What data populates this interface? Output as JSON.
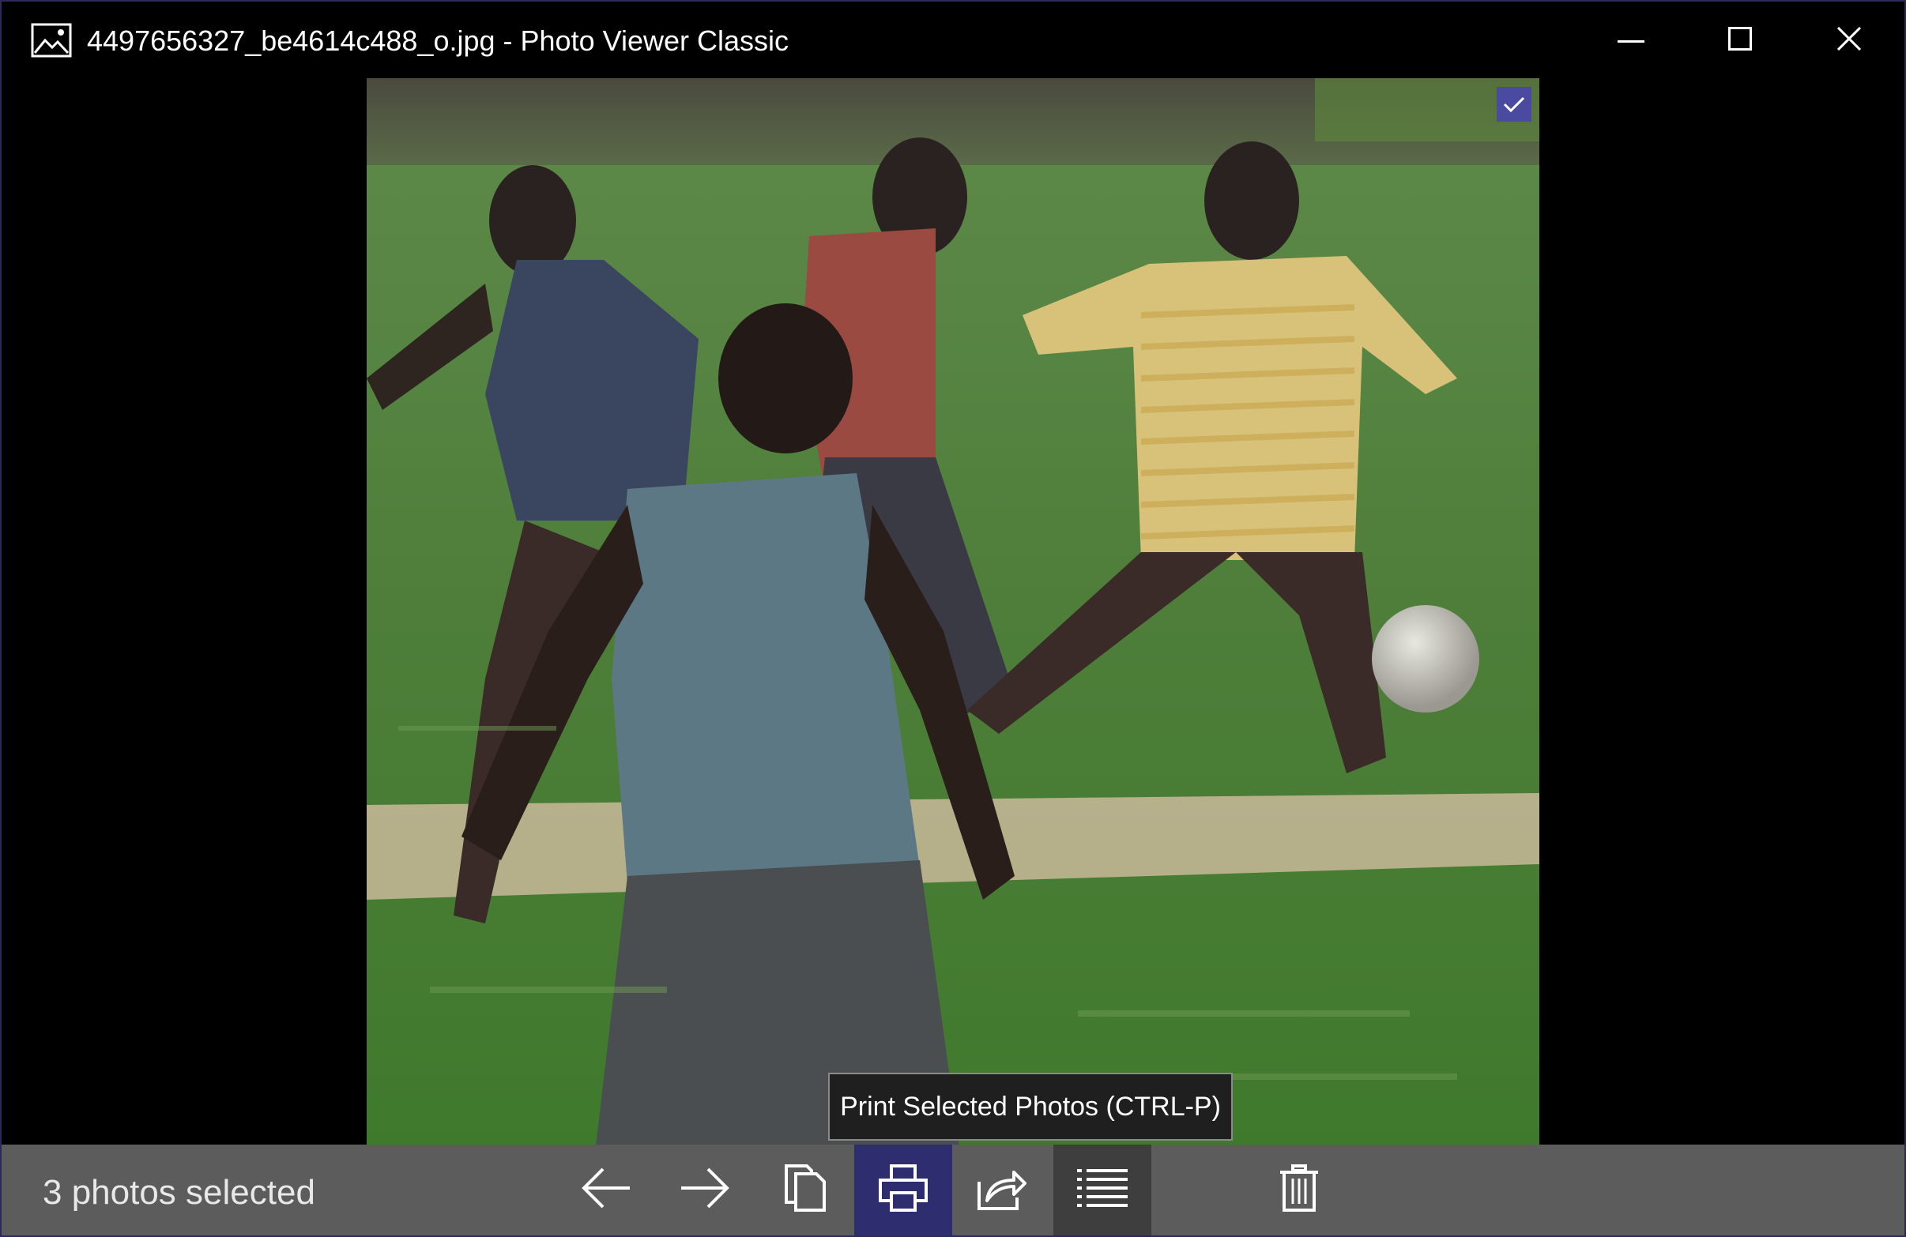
{
  "window": {
    "title": "4497656327_be4614c488_o.jpg - Photo Viewer Classic",
    "app_icon": "image-icon",
    "controls": {
      "minimize_icon": "minimize-icon",
      "maximize_icon": "maximize-icon",
      "close_icon": "close-icon"
    }
  },
  "photo": {
    "selected": true,
    "check_icon": "checkmark-icon"
  },
  "tooltip": {
    "text": "Print Selected Photos (CTRL-P)"
  },
  "toolbar": {
    "status": "3 photos selected",
    "buttons": [
      {
        "icon": "arrow-left-icon",
        "state": "normal"
      },
      {
        "icon": "arrow-right-icon",
        "state": "normal"
      },
      {
        "icon": "copy-icon",
        "state": "normal"
      },
      {
        "icon": "printer-icon",
        "state": "active"
      },
      {
        "icon": "share-icon",
        "state": "normal"
      },
      {
        "icon": "list-icon",
        "state": "hover"
      },
      {
        "icon": "trash-icon",
        "state": "normal"
      }
    ]
  },
  "colors": {
    "accent": "#2d2d70",
    "toolbar_bg": "#5c5c5c",
    "window_bg": "#000000",
    "border": "#2b2b56"
  }
}
